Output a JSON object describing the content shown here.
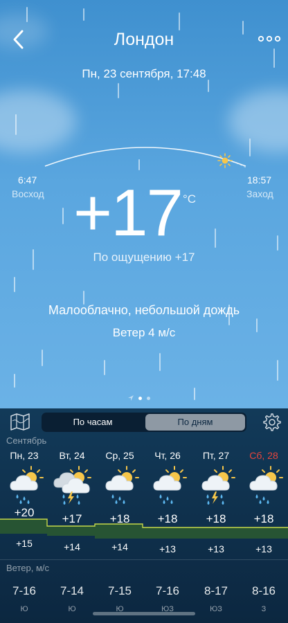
{
  "header": {
    "city": "Лондон",
    "date": "Пн, 23 сентября, 17:48"
  },
  "sun": {
    "sunrise_time": "6:47",
    "sunrise_label": "Восход",
    "sunset_time": "18:57",
    "sunset_label": "Заход"
  },
  "current": {
    "temperature": "+17",
    "unit": "°C",
    "feels_like": "По ощущению +17",
    "condition": "Малооблачно, небольшой дождь",
    "wind": "Ветер 4 м/с"
  },
  "tabs": {
    "hourly": "По часам",
    "daily": "По дням"
  },
  "forecast": {
    "month": "Сентябрь",
    "days": [
      {
        "label": "Пн, 23",
        "icon": "sun-cloud-rain-icon",
        "high": "+20",
        "low": "+15",
        "wind": "7-16",
        "dir": "Ю"
      },
      {
        "label": "Вт, 24",
        "icon": "cloud-thunder-rain-icon",
        "high": "+17",
        "low": "+14",
        "wind": "7-14",
        "dir": "Ю"
      },
      {
        "label": "Ср, 25",
        "icon": "sun-cloud-rain-icon",
        "high": "+18",
        "low": "+14",
        "wind": "7-15",
        "dir": "Ю"
      },
      {
        "label": "Чт, 26",
        "icon": "sun-cloud-rain-icon",
        "high": "+18",
        "low": "+13",
        "wind": "7-16",
        "dir": "ЮЗ"
      },
      {
        "label": "Пт, 27",
        "icon": "sun-cloud-thunder-rain-icon",
        "high": "+18",
        "low": "+13",
        "wind": "8-17",
        "dir": "ЮЗ"
      },
      {
        "label": "Сб, 28",
        "icon": "sun-cloud-rain-icon",
        "high": "+18",
        "low": "+13",
        "wind": "8-16",
        "dir": "З"
      }
    ],
    "wind_title": "Ветер, м/с"
  },
  "colors": {
    "weekend": "#e8453c",
    "sun": "#f6c64a",
    "rain": "#5db8f0",
    "band_line": "#c6d84a",
    "band_fill": "#2c5b2f"
  }
}
